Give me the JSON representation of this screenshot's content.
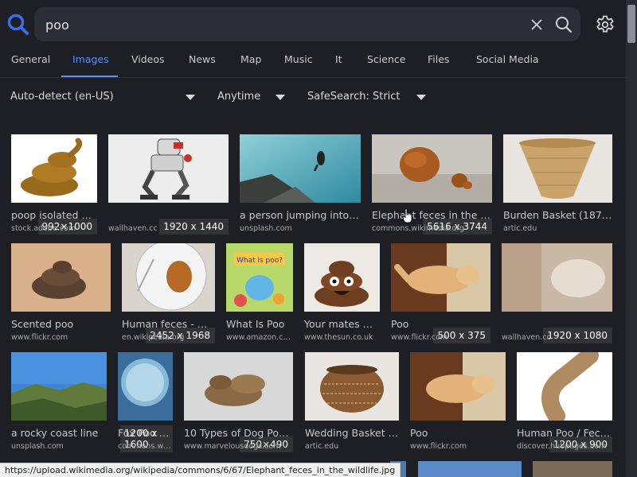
{
  "search": {
    "query": "poo",
    "placeholder": ""
  },
  "tabs": [
    {
      "label": "General"
    },
    {
      "label": "Images"
    },
    {
      "label": "Videos"
    },
    {
      "label": "News"
    },
    {
      "label": "Map"
    },
    {
      "label": "Music"
    },
    {
      "label": "It"
    },
    {
      "label": "Science"
    },
    {
      "label": "Files"
    },
    {
      "label": "Social Media"
    }
  ],
  "filters": {
    "language": "Auto-detect (en-US)",
    "time": "Anytime",
    "safesearch": "SafeSearch: Strict"
  },
  "results": [
    {
      "title": "poop isolated on…",
      "source": "stock.adobe.com",
      "dims": "992×1000"
    },
    {
      "title": "",
      "source": "wallhaven.cc",
      "dims": "1920 x 1440"
    },
    {
      "title": "a person jumping into a…",
      "source": "unsplash.com",
      "dims": ""
    },
    {
      "title": "Elephant feces in the wil…",
      "source": "commons.wikimedia.org",
      "dims": "5616 x 3744"
    },
    {
      "title": "Burden Basket (1870…",
      "source": "artic.edu",
      "dims": ""
    },
    {
      "title": "Scented poo",
      "source": "www.flickr.com",
      "dims": ""
    },
    {
      "title": "Human feces - Wi…",
      "source": "en.wikipedia.org",
      "dims": "2452 x 1968"
    },
    {
      "title": "What Is Poo",
      "source": "www.amazon.c…",
      "dims": ""
    },
    {
      "title": "Your mates wi…",
      "source": "www.thesun.co.uk",
      "dims": ""
    },
    {
      "title": "Poo",
      "source": "www.flickr.com",
      "dims": "500 x 375"
    },
    {
      "title": "",
      "source": "wallhaven.cc",
      "dims": "1920 x 1080"
    },
    {
      "title": "a rocky coast line",
      "source": "unsplash.com",
      "dims": ""
    },
    {
      "title": "Fox Poo …",
      "source": "commons.wik…",
      "dims": "1200 x 1600"
    },
    {
      "title": "10 Types of Dog Poop…",
      "source": "www.marvelousdogs.com",
      "dims": "750×490"
    },
    {
      "title": "Wedding Basket (…",
      "source": "artic.edu",
      "dims": ""
    },
    {
      "title": "Poo",
      "source": "www.flickr.com",
      "dims": ""
    },
    {
      "title": "Human Poo / Fece…",
      "source": "discover.hubpages.com",
      "dims": "1200 x 900"
    }
  ],
  "thumb_text": {
    "book_title": "What is poo?"
  },
  "status_url": "https://upload.wikimedia.org/wikipedia/commons/6/67/Elephant_feces_in_the_wildlife.jpg",
  "colors": {
    "accent": "#5d8ff5",
    "background": "#1e1f24",
    "search_bg": "#2c2e36"
  },
  "icons": {
    "logo": "searxng-magnifier-icon",
    "clear": "close-icon",
    "search": "search-icon",
    "settings": "gear-icon"
  }
}
